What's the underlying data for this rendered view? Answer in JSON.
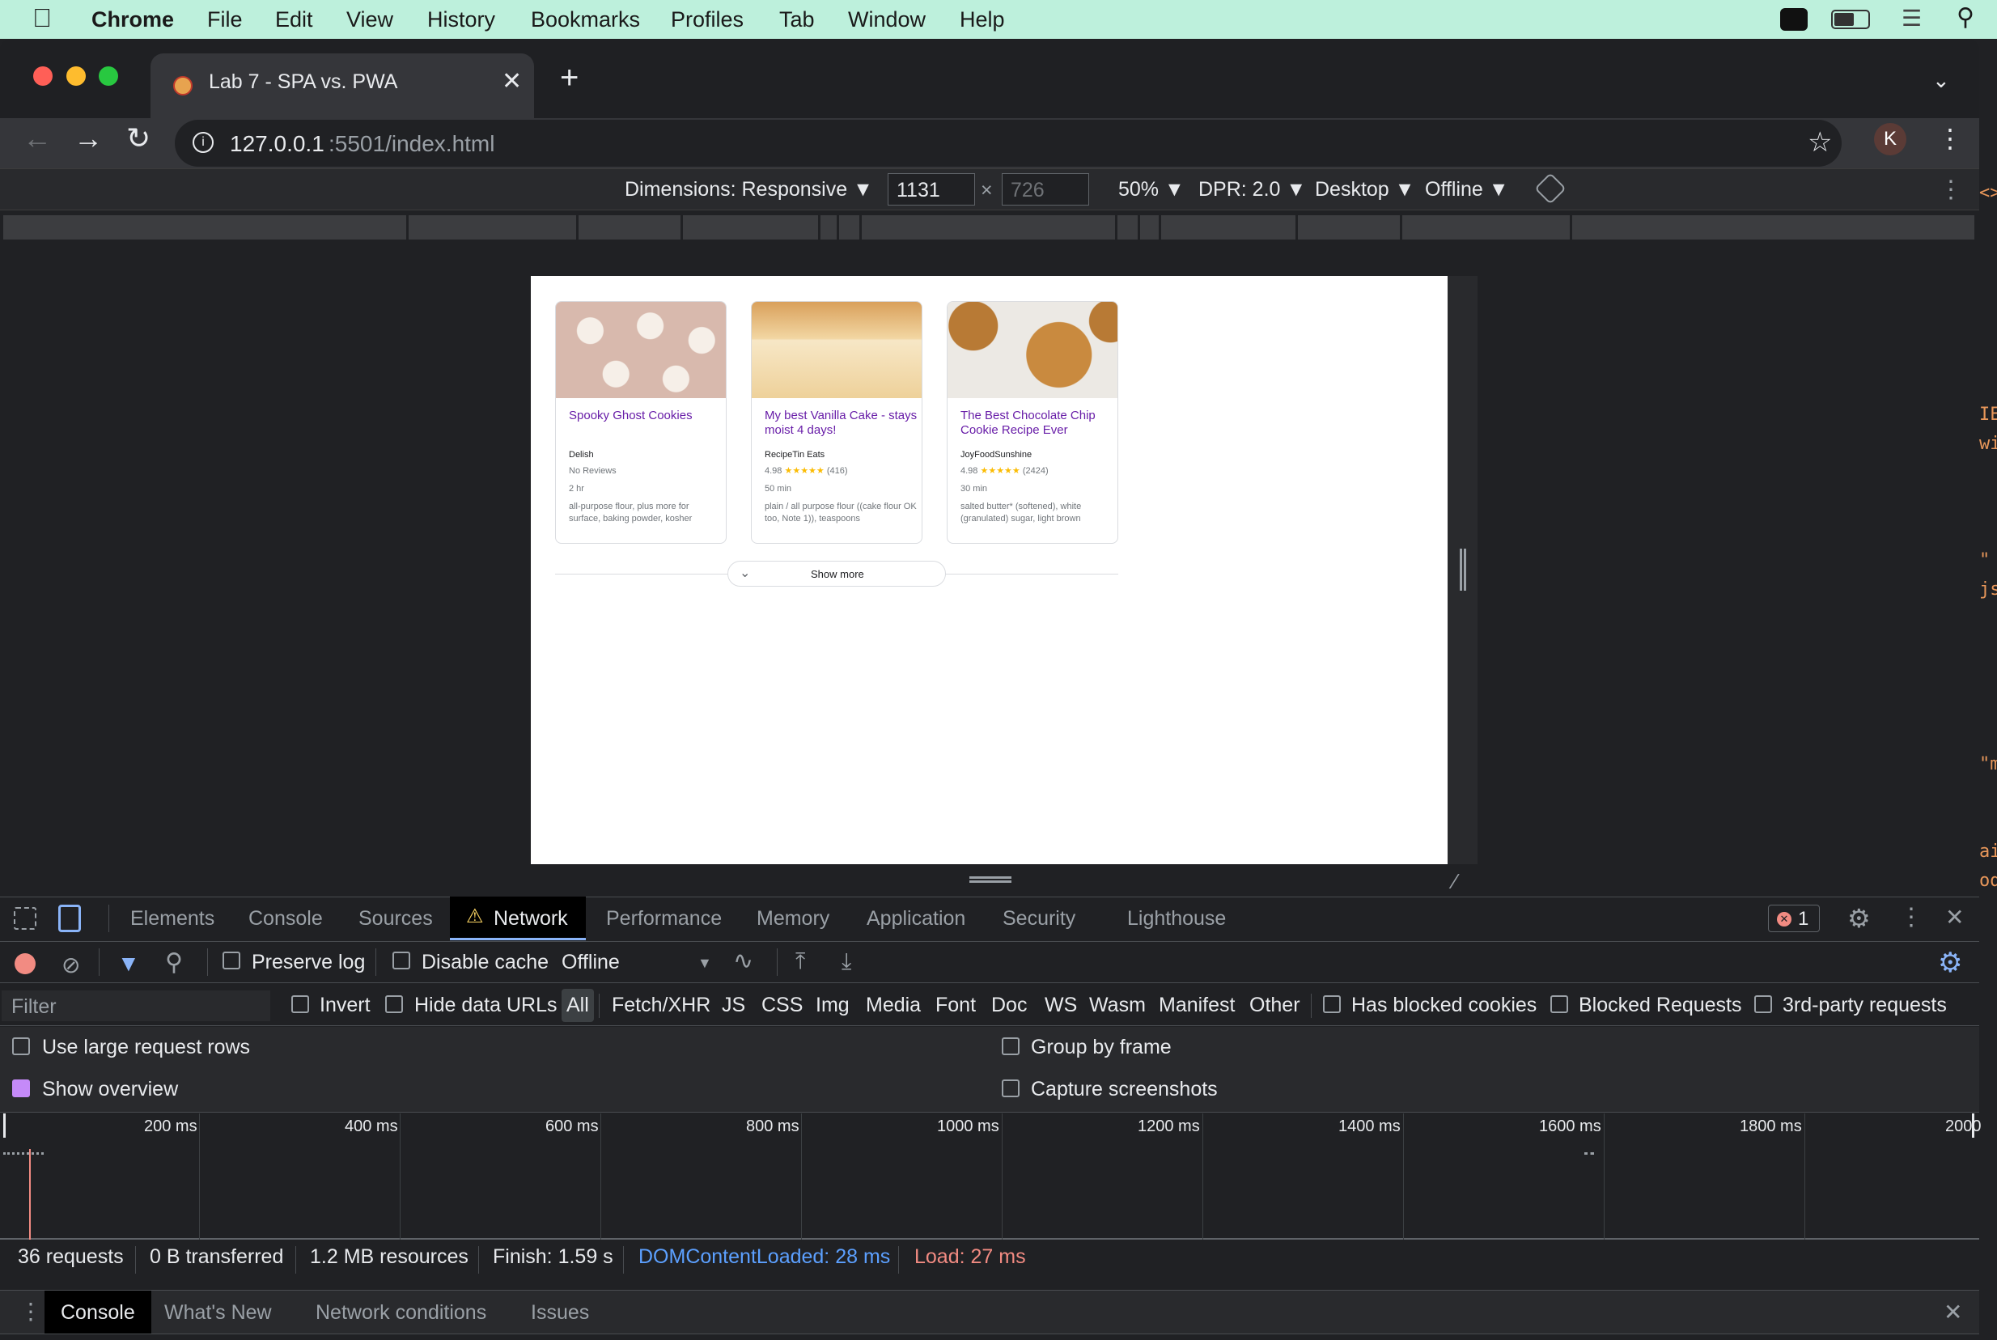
{
  "menubar": {
    "app": "Chrome",
    "items": [
      "File",
      "Edit",
      "View",
      "History",
      "Bookmarks",
      "Profiles",
      "Tab",
      "Window",
      "Help"
    ]
  },
  "tab": {
    "title": "Lab 7 - SPA vs. PWA"
  },
  "address": {
    "host": "127.0.0.1",
    "rest": ":5501/index.html"
  },
  "profile": {
    "initial": "K"
  },
  "device_toolbar": {
    "dimensions": "Dimensions: Responsive ▼",
    "width": "1131",
    "height": "726",
    "times": "×",
    "zoom": "50% ▼",
    "dpr": "DPR: 2.0 ▼",
    "mode": "Desktop ▼",
    "throttle": "Offline ▼"
  },
  "cards": [
    {
      "title": "Spooky Ghost Cookies",
      "source": "Delish",
      "rating": "No Reviews",
      "time": "2 hr",
      "ingredients": "all-purpose flour, plus more for surface, baking powder, kosher"
    },
    {
      "title": "My best Vanilla Cake - stays moist 4 days!",
      "source": "RecipeTin Eats",
      "rating": "4.98 ★★★★★ (416)",
      "time": "50 min",
      "ingredients": "plain / all purpose flour ((cake flour OK too, Note 1)), teaspoons"
    },
    {
      "title": "The Best Chocolate Chip Cookie Recipe Ever",
      "source": "JoyFoodSunshine",
      "rating": "4.98 ★★★★★ (2424)",
      "time": "30 min",
      "ingredients": "salted butter* (softened), white (granulated) sugar, light brown"
    }
  ],
  "show_more": "Show more",
  "devtools": {
    "tabs": [
      "Elements",
      "Console",
      "Sources",
      "Network",
      "Performance",
      "Memory",
      "Application",
      "Security",
      "Lighthouse"
    ],
    "error_count": "1",
    "network_toolbar": {
      "preserve_log": "Preserve log",
      "disable_cache": "Disable cache",
      "throttle": "Offline"
    },
    "filter": {
      "placeholder": "Filter",
      "invert": "Invert",
      "hide_data_urls": "Hide data URLs",
      "types": [
        "All",
        "Fetch/XHR",
        "JS",
        "CSS",
        "Img",
        "Media",
        "Font",
        "Doc",
        "WS",
        "Wasm",
        "Manifest",
        "Other"
      ],
      "has_blocked_cookies": "Has blocked cookies",
      "blocked_requests": "Blocked Requests",
      "third_party": "3rd-party requests"
    },
    "settings": {
      "large_rows": "Use large request rows",
      "show_overview": "Show overview",
      "group_by_frame": "Group by frame",
      "capture_screenshots": "Capture screenshots"
    },
    "timeline_labels": [
      "200 ms",
      "400 ms",
      "600 ms",
      "800 ms",
      "1000 ms",
      "1200 ms",
      "1400 ms",
      "1600 ms",
      "1800 ms",
      "2000"
    ],
    "status": {
      "requests": "36 requests",
      "transferred": "0 B transferred",
      "resources": "1.2 MB resources",
      "finish": "Finish: 1.59 s",
      "dcl": "DOMContentLoaded: 28 ms",
      "load": "Load: 27 ms"
    },
    "drawer_tabs": [
      "Console",
      "What's New",
      "Network conditions",
      "Issues"
    ]
  },
  "colors": {
    "accent": "#8ab4f8",
    "dcl": "#5ca0ff",
    "load": "#f28b82",
    "menubar": "#bdf0dc"
  }
}
